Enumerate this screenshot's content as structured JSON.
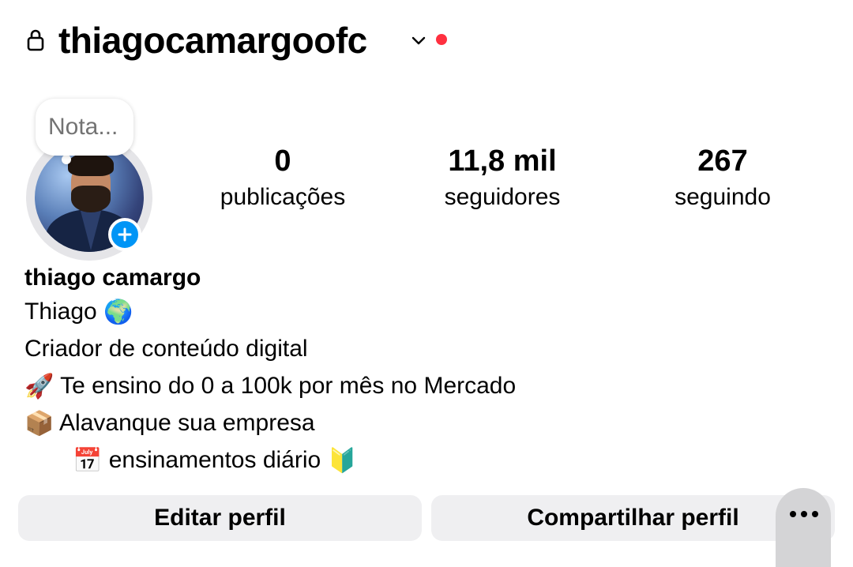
{
  "header": {
    "username": "thiagocamargoofc",
    "lock_icon": "lock-icon",
    "chevron_icon": "chevron-down-icon",
    "notification_color": "#ff3040"
  },
  "note": {
    "placeholder": "Nota..."
  },
  "stats": {
    "posts": {
      "value": "0",
      "label": "publicações"
    },
    "followers": {
      "value": "11,8 mil",
      "label": "seguidores"
    },
    "following": {
      "value": "267",
      "label": "seguindo"
    }
  },
  "bio": {
    "name": "thiago camargo",
    "line1": {
      "text": "Thiago",
      "emoji": "🌍"
    },
    "line2": {
      "text": "Criador de conteúdo digital"
    },
    "line3": {
      "emoji": "🚀",
      "text": "Te ensino do 0 a 100k por mês no Mercado"
    },
    "line4": {
      "emoji": "📦",
      "text": "Alavanque sua empresa"
    },
    "line5": {
      "emoji_start": "📅",
      "text": "ensinamentos diário",
      "emoji_end": "🔰"
    }
  },
  "buttons": {
    "edit_label": "Editar perfil",
    "share_label": "Compartilhar perfil",
    "more_icon": "more-horizontal-icon"
  },
  "colors": {
    "accent_blue": "#0095f6",
    "button_bg": "#efeff1",
    "muted_text": "#737373"
  }
}
